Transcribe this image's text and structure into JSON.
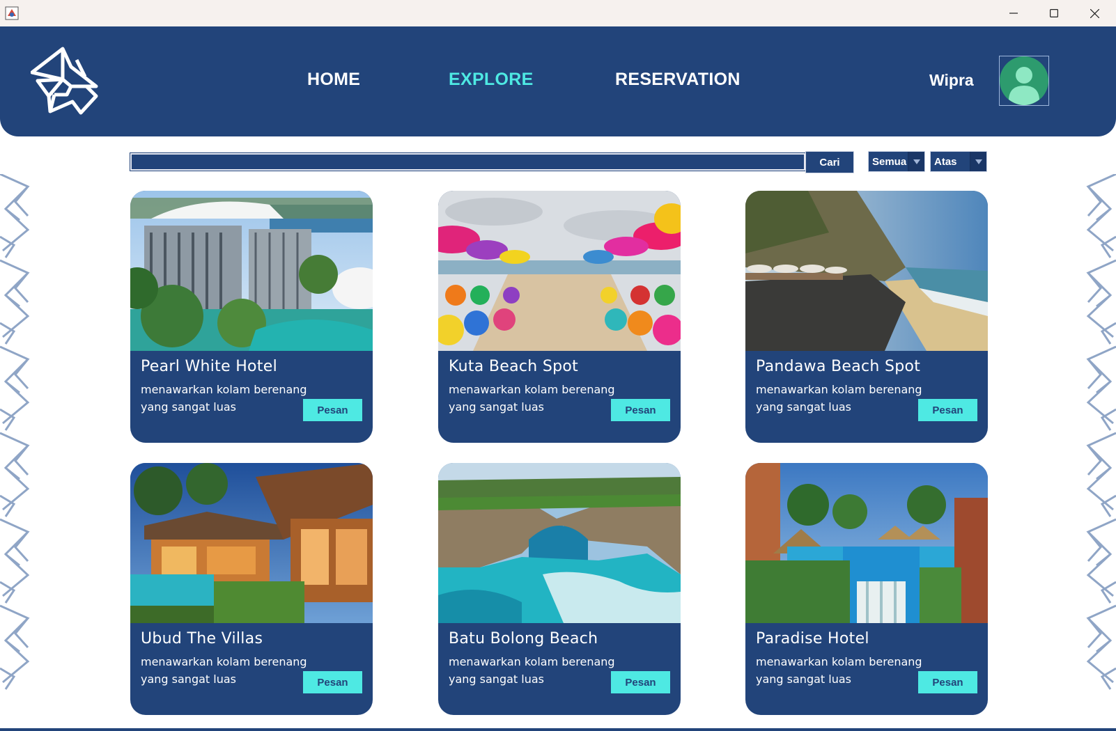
{
  "window": {
    "minimize_icon": "minimize-icon",
    "maximize_icon": "maximize-icon",
    "close_icon": "close-icon"
  },
  "header": {
    "nav": [
      {
        "label": "HOME",
        "active": false
      },
      {
        "label": "EXPLORE",
        "active": true
      },
      {
        "label": "RESERVATION",
        "active": false
      }
    ],
    "username": "Wipra",
    "colors": {
      "background": "#22447a",
      "active_link": "#4ee9e3",
      "link": "#ffffff"
    }
  },
  "search": {
    "value": "",
    "button_label": "Cari",
    "category_select": "Semua",
    "sort_select": "Atas"
  },
  "cards": [
    {
      "title": "Pearl White Hotel",
      "description": "menawarkan kolam berenang yang sangat luas",
      "button_label": "Pesan",
      "image": "hotel-building-pool-photo"
    },
    {
      "title": "Kuta Beach Spot",
      "description": "menawarkan kolam berenang yang sangat luas",
      "button_label": "Pesan",
      "image": "beach-umbrellas-photo"
    },
    {
      "title": "Pandawa Beach Spot",
      "description": "menawarkan kolam berenang yang sangat luas",
      "button_label": "Pesan",
      "image": "cliff-beach-photo"
    },
    {
      "title": "Ubud The Villas",
      "description": "menawarkan kolam berenang yang sangat luas",
      "button_label": "Pesan",
      "image": "villa-pool-photo"
    },
    {
      "title": "Batu Bolong Beach",
      "description": "menawarkan kolam berenang yang sangat luas",
      "button_label": "Pesan",
      "image": "rock-arch-sea-photo"
    },
    {
      "title": "Paradise Hotel",
      "description": "menawarkan kolam berenang yang sangat luas",
      "button_label": "Pesan",
      "image": "resort-pool-photo"
    }
  ]
}
